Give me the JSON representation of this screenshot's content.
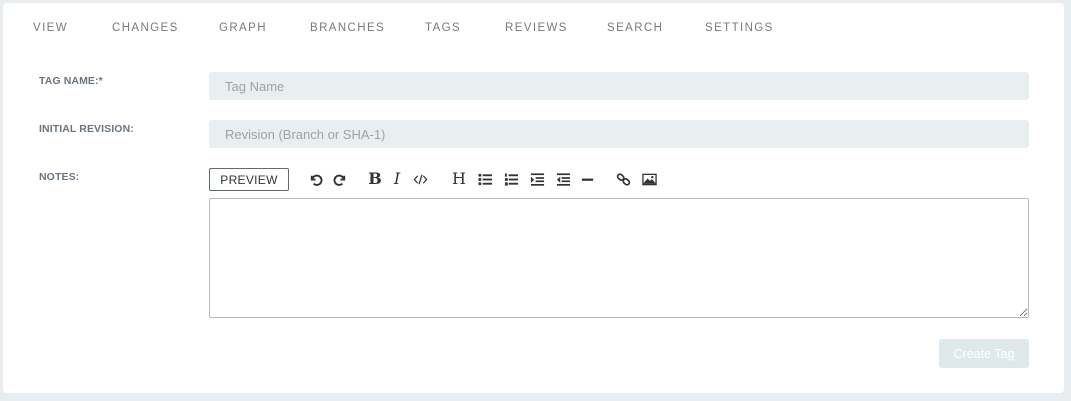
{
  "tabs": [
    {
      "label": "VIEW"
    },
    {
      "label": "CHANGES"
    },
    {
      "label": "GRAPH"
    },
    {
      "label": "BRANCHES"
    },
    {
      "label": "TAGS"
    },
    {
      "label": "REVIEWS"
    },
    {
      "label": "SEARCH"
    },
    {
      "label": "SETTINGS"
    }
  ],
  "form": {
    "tag_name": {
      "label": "TAG NAME:*",
      "value": "",
      "placeholder": "Tag Name"
    },
    "initial_revision": {
      "label": "INITIAL REVISION:",
      "value": "",
      "placeholder": "Revision (Branch or SHA-1)"
    },
    "notes": {
      "label": "NOTES:",
      "value": ""
    }
  },
  "editor_toolbar": {
    "preview_label": "PREVIEW",
    "tools": [
      "undo-icon",
      "redo-icon",
      "bold-icon",
      "italic-icon",
      "code-icon",
      "heading-icon",
      "bullet-list-icon",
      "numbered-list-icon",
      "indent-icon",
      "outdent-icon",
      "horizontal-rule-icon",
      "link-icon",
      "image-icon"
    ]
  },
  "actions": {
    "create_label": "Create Tag"
  },
  "colors": {
    "background": "#e8eef0",
    "field_bg": "#e9eff1",
    "disabled_button": "#dfe8ea"
  }
}
